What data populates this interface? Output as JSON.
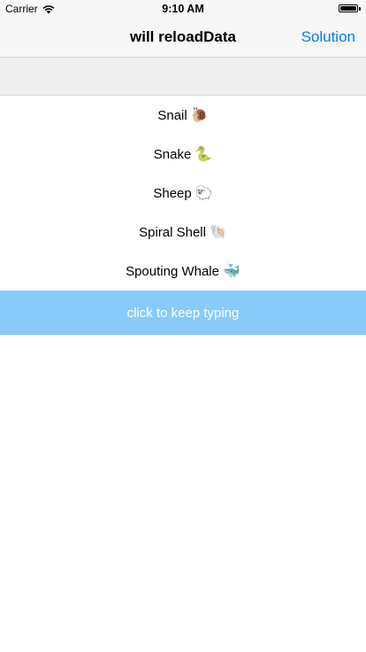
{
  "status_bar": {
    "carrier": "Carrier",
    "wifi_icon": "wifi-icon",
    "time": "9:10 AM",
    "battery_icon": "battery-icon"
  },
  "nav": {
    "title": "will reloadData",
    "right_button": "Solution"
  },
  "search": {
    "value": "",
    "placeholder": ""
  },
  "list": {
    "items": [
      {
        "label": "Snail",
        "emoji": "🐌"
      },
      {
        "label": "Snake",
        "emoji": "🐍"
      },
      {
        "label": "Sheep",
        "emoji": "🐑"
      },
      {
        "label": "Spiral Shell",
        "emoji": "🐚"
      },
      {
        "label": "Spouting Whale",
        "emoji": "🐳"
      }
    ]
  },
  "keep_typing": {
    "label": "click to keep typing"
  },
  "colors": {
    "accent": "#007aff",
    "keep_typing_bg": "#88cbfa",
    "bar_bg": "#f7f7f7",
    "search_bg": "#efefef"
  }
}
